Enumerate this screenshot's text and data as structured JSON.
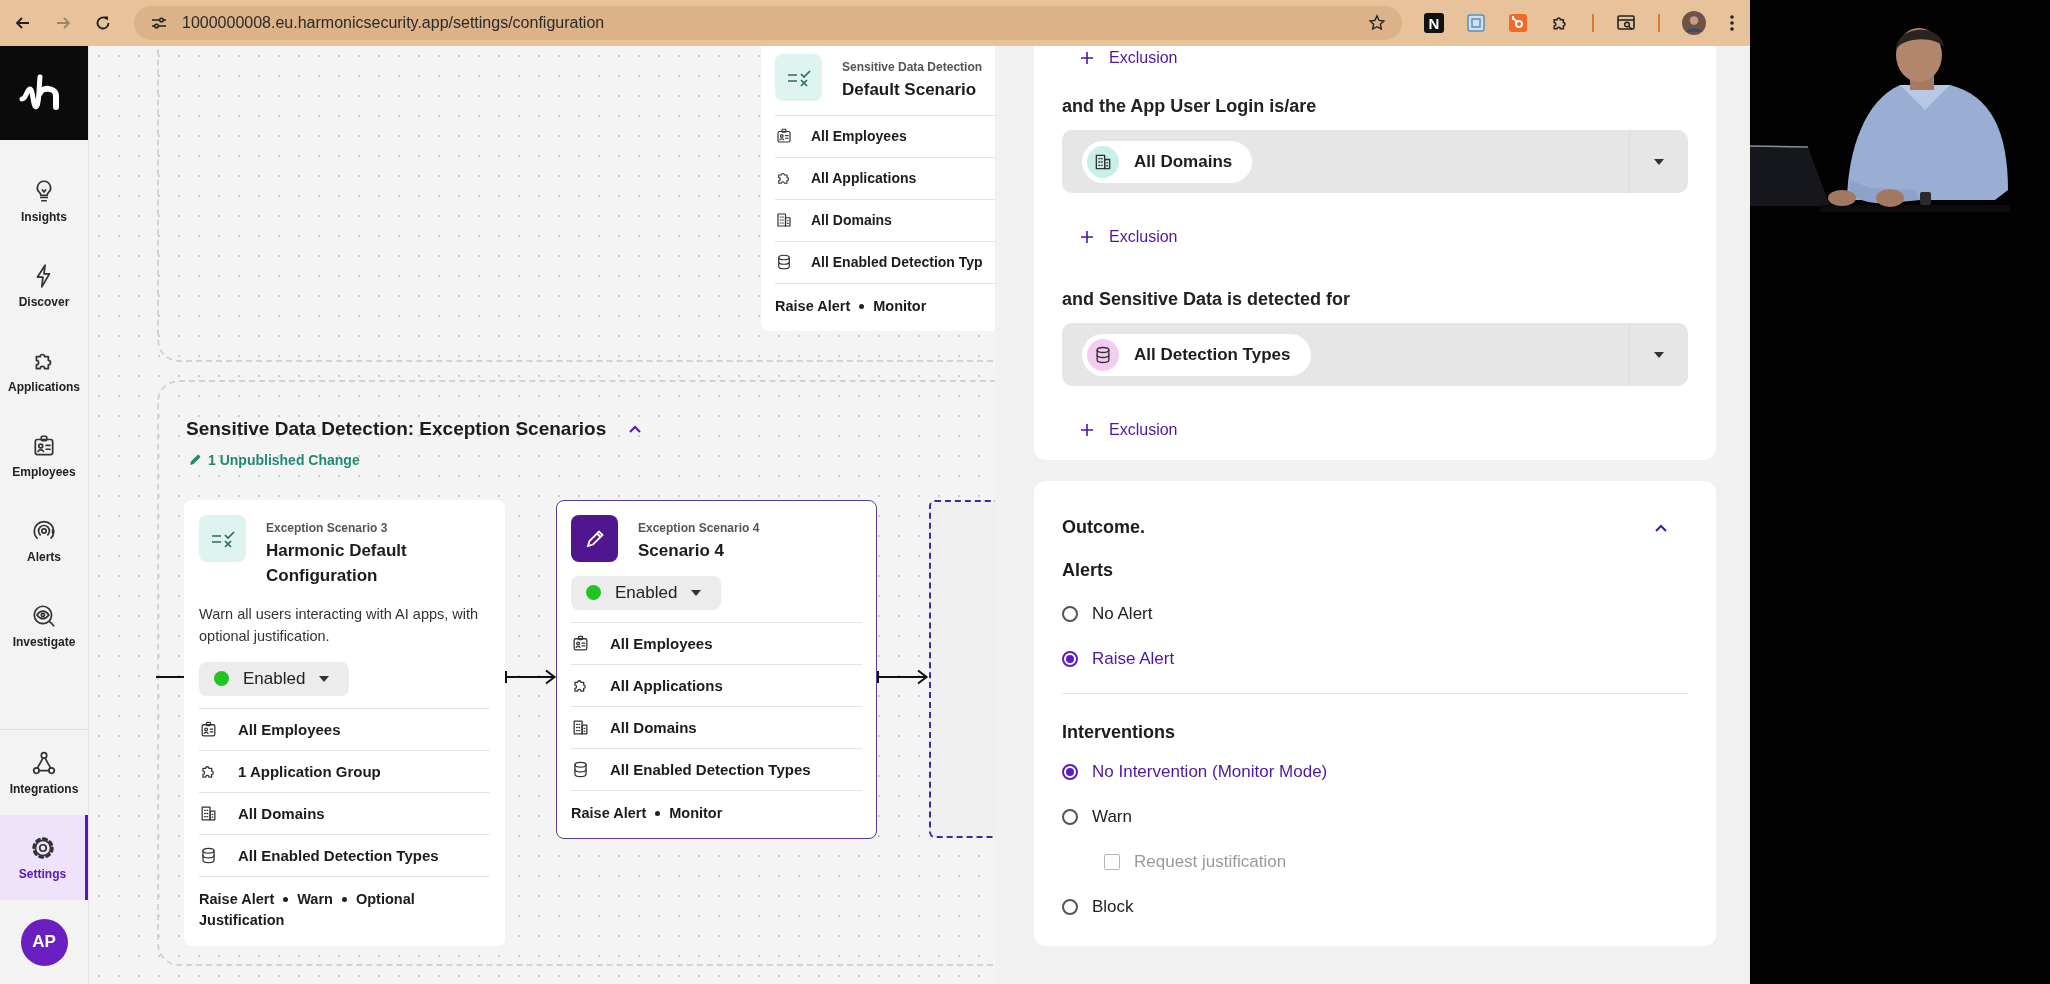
{
  "browser": {
    "url": "1000000008.eu.harmonicsecurity.app/settings/configuration",
    "extension_letter": "N"
  },
  "sidebar": {
    "items": [
      {
        "label": "Insights",
        "kind": "insights",
        "selected": false
      },
      {
        "label": "Discover",
        "kind": "discover",
        "selected": false
      },
      {
        "label": "Applications",
        "kind": "applications",
        "selected": false
      },
      {
        "label": "Employees",
        "kind": "employees",
        "selected": false
      },
      {
        "label": "Alerts",
        "kind": "alerts",
        "selected": false
      },
      {
        "label": "Investigate",
        "kind": "investigate",
        "selected": false
      }
    ],
    "bottom_items": [
      {
        "label": "Integrations",
        "kind": "integrations",
        "selected": false
      },
      {
        "label": "Settings",
        "kind": "settings",
        "selected": true
      }
    ],
    "avatar": "AP"
  },
  "canvas": {
    "default_scenario": {
      "overline": "Sensitive Data Detection",
      "title": "Default Scenario",
      "rows": [
        {
          "kind": "employees",
          "text": "All Employees"
        },
        {
          "kind": "applications",
          "text": "All Applications"
        },
        {
          "kind": "domains",
          "text": "All Domains"
        },
        {
          "kind": "detection",
          "text": "All Enabled Detection Typ"
        }
      ],
      "outcome": [
        "Raise Alert",
        "Monitor"
      ]
    },
    "exception_group": {
      "title": "Sensitive Data Detection: Exception Scenarios",
      "expanded": true,
      "change_note": "1 Unpublished Change",
      "scenarios": [
        {
          "overline": "Exception Scenario 3",
          "title": "Harmonic Default Configuration",
          "kind": "rules",
          "selected": false,
          "description": "Warn all users interacting with AI apps, with optional justification.",
          "status": {
            "label": "Enabled",
            "on": true
          },
          "rows": [
            {
              "kind": "employees",
              "text": "All Employees"
            },
            {
              "kind": "applications",
              "text": "1 Application Group"
            },
            {
              "kind": "domains",
              "text": "All Domains"
            },
            {
              "kind": "detection",
              "text": "All Enabled Detection Types"
            }
          ],
          "outcome": [
            "Raise Alert",
            "Warn",
            "Optional Justification"
          ]
        },
        {
          "overline": "Exception Scenario 4",
          "title": "Scenario 4",
          "kind": "edit",
          "selected": true,
          "status": {
            "label": "Enabled",
            "on": true
          },
          "rows": [
            {
              "kind": "employees",
              "text": "All Employees"
            },
            {
              "kind": "applications",
              "text": "All Applications"
            },
            {
              "kind": "domains",
              "text": "All Domains"
            },
            {
              "kind": "detection",
              "text": "All Enabled Detection Types"
            }
          ],
          "outcome": [
            "Raise Alert",
            "Monitor"
          ]
        }
      ]
    }
  },
  "conditions": {
    "top_exclusion": "Exclusion",
    "groups": [
      {
        "label": "and the App User Login is/are",
        "chip": {
          "kind": "domains",
          "text": "All Domains"
        },
        "exclusion": "Exclusion"
      },
      {
        "label": "and Sensitive Data is detected for",
        "chip": {
          "kind": "detection",
          "text": "All Detection Types"
        },
        "exclusion": "Exclusion"
      }
    ]
  },
  "outcome": {
    "title": "Outcome.",
    "expanded": true,
    "alerts": {
      "title": "Alerts",
      "options": [
        {
          "label": "No Alert",
          "selected": false
        },
        {
          "label": "Raise Alert",
          "selected": true
        }
      ]
    },
    "interventions": {
      "title": "Interventions",
      "options": [
        {
          "label": "No Intervention (Monitor Mode)",
          "selected": true
        },
        {
          "label": "Warn",
          "selected": false,
          "sub": {
            "label": "Request justification",
            "checked": false,
            "disabled": true
          }
        },
        {
          "label": "Block",
          "selected": false
        }
      ]
    }
  }
}
